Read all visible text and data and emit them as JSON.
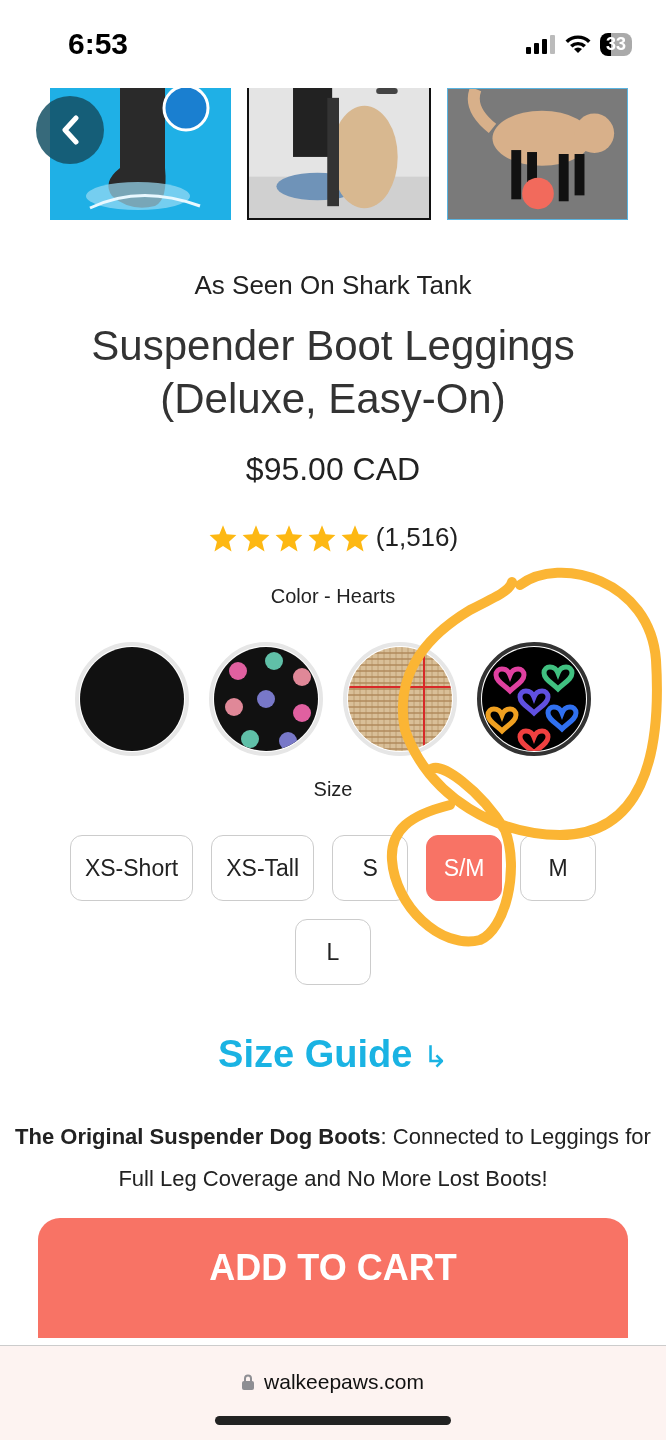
{
  "status_bar": {
    "time": "6:53",
    "battery": "33"
  },
  "product": {
    "tagline": "As Seen On Shark Tank",
    "title": "Suspender Boot Leggings (Deluxe, Easy-On)",
    "price": "$95.00 CAD",
    "stars": 5,
    "review_count": "(1,516)"
  },
  "color": {
    "label": "Color - Hearts",
    "swatches": [
      {
        "kind": "solid",
        "selected": false
      },
      {
        "kind": "dots",
        "selected": false
      },
      {
        "kind": "plaid",
        "selected": false
      },
      {
        "kind": "hearts",
        "selected": true
      }
    ]
  },
  "size": {
    "label": "Size",
    "options": [
      {
        "label": "XS-Short",
        "selected": false
      },
      {
        "label": "XS-Tall",
        "selected": false
      },
      {
        "label": "S",
        "selected": false
      },
      {
        "label": "S/M",
        "selected": true
      },
      {
        "label": "M",
        "selected": false
      },
      {
        "label": "L",
        "selected": false
      }
    ]
  },
  "size_guide": {
    "label": "Size Guide",
    "icon": "↳"
  },
  "description": "**The Original Suspender Dog Boots**: Connected to Leggings for Full Leg Coverage and No More Lost Boots!",
  "add_to_cart": "ADD TO CART",
  "browser": {
    "url": "walkeepaws.com"
  }
}
